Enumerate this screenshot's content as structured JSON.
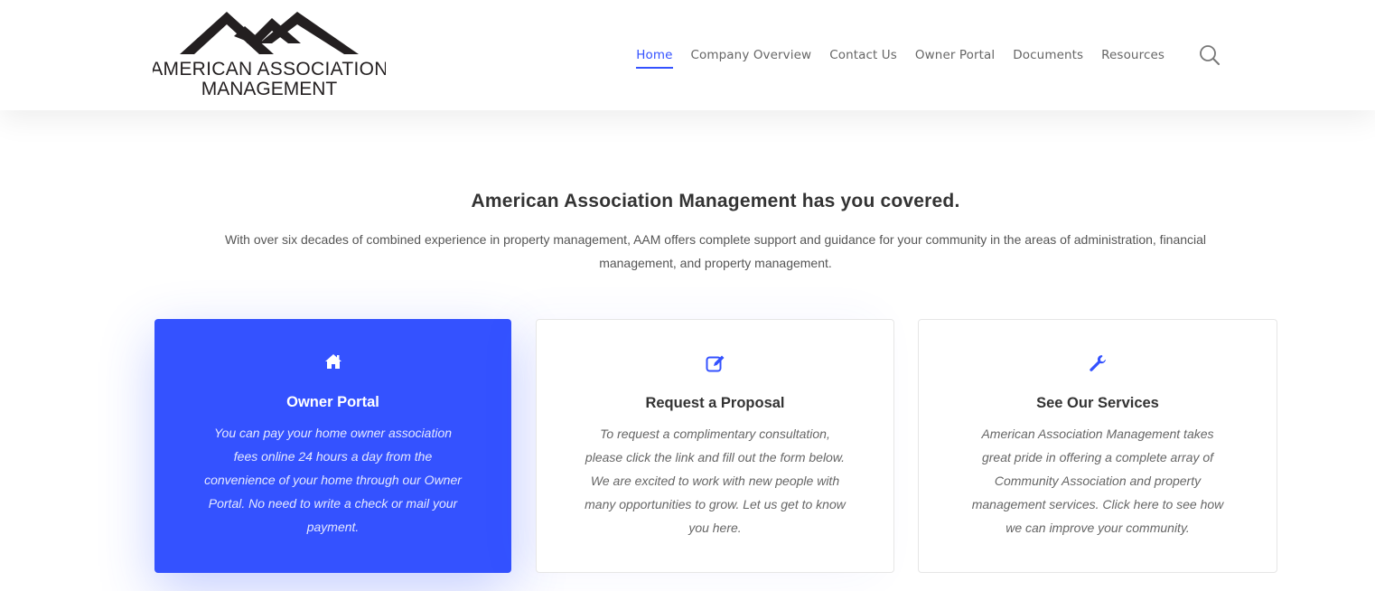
{
  "header": {
    "logo": {
      "line1": "AMERICAN ASSOCIATION",
      "line2": "MANAGEMENT"
    },
    "nav": [
      {
        "label": "Home",
        "active": true
      },
      {
        "label": "Company Overview",
        "active": false
      },
      {
        "label": "Contact Us",
        "active": false
      },
      {
        "label": "Owner Portal",
        "active": false
      },
      {
        "label": "Documents",
        "active": false
      },
      {
        "label": "Resources",
        "active": false
      }
    ],
    "search_icon": "search-icon"
  },
  "intro": {
    "title": "American Association Management has you covered.",
    "text": "With over six decades of combined experience in property management, AAM offers complete support and guidance for your community in the areas of administration, financial management, and property management."
  },
  "cards": [
    {
      "icon": "home-icon",
      "title": "Owner Portal",
      "text": "You can pay your home owner association fees online 24 hours a day from the convenience of your home through our Owner Portal. No need to write a check or mail your payment."
    },
    {
      "icon": "edit-icon",
      "title": "Request a Proposal",
      "text": "To request a complimentary consultation, please click the link and fill out the form below. We are excited to work with new people with many opportunities to grow. Let us get to know you here."
    },
    {
      "icon": "wrench-icon",
      "title": "See Our Services",
      "text": "American Association Management takes great pride in offering a complete array of Community Association and property management services. Click here to see how we can improve your community."
    }
  ],
  "colors": {
    "accent": "#3452ff",
    "text_dark": "#333333",
    "text_muted": "#666666"
  }
}
